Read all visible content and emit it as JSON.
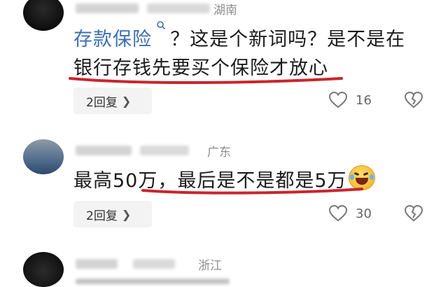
{
  "comments": [
    {
      "location": "湖南",
      "text_link": "存款保险",
      "text_line1_rest": "？这是个新词吗？是不是在",
      "text_line2": "银行存钱先要买个保险才放心",
      "replies_label": "2回复",
      "likes": "16"
    },
    {
      "location": "广东",
      "text": "最高50万，最后是不是都是5万",
      "replies_label": "2回复",
      "likes": "30"
    },
    {
      "location": "浙江"
    }
  ],
  "icons": {
    "search": "search-icon",
    "like": "heart-outline-icon",
    "dislike": "broken-heart-icon",
    "emoji": "laughing-crying-emoji-icon",
    "chevron": "chevron-right-icon"
  },
  "colors": {
    "link": "#3d6fb0",
    "underline": "#c9252c"
  }
}
